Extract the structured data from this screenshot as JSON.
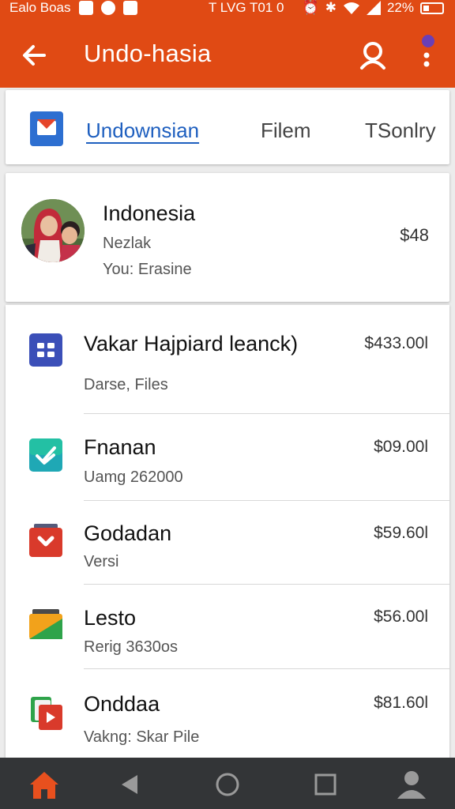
{
  "status_bar": {
    "left_text": "Ealo Boas",
    "center_text": "T LVG T01 0",
    "battery": "22%",
    "left_icons": [
      "notification-icon",
      "circle-icon",
      "calendar-icon"
    ],
    "right_icons": [
      "alarm-icon",
      "bluetooth-icon",
      "wifi-icon",
      "signal-icon",
      "battery-icon"
    ]
  },
  "app_bar": {
    "title": "Undo-hasia",
    "back_icon": "arrow-left-icon",
    "search_icon": "search-icon",
    "more_icon": "more-vertical-icon",
    "accent": "#e04a14"
  },
  "tabs": {
    "items": [
      {
        "label": "Undownsian",
        "active": true
      },
      {
        "label": "Filem",
        "active": false
      },
      {
        "label": "TSonlry",
        "active": false
      }
    ],
    "active_color": "#1e5fbf"
  },
  "profile": {
    "name": "Indonesia",
    "subtitle": "Nezlak",
    "detail": "You: Erasine",
    "price": "$48"
  },
  "items": [
    {
      "title": "Vakar Hajpiard leanck)",
      "subtitle": "Darse, Files",
      "price": "$433.00l",
      "icon": "grid-app-icon",
      "color": "#3b4fb8"
    },
    {
      "title": "Fnanan",
      "subtitle": "Uamg 262000",
      "price": "$09.00l",
      "icon": "checkmark-app-icon",
      "color": "#1fa8b5"
    },
    {
      "title": "Godadan",
      "subtitle": "Versi",
      "price": "$59.60l",
      "icon": "play-folder-icon",
      "color": "#d93a2b"
    },
    {
      "title": "Lesto",
      "subtitle": "Rerig 3630os",
      "price": "$56.00l",
      "icon": "folder-triangle-icon",
      "color": "#f2a21b"
    },
    {
      "title": "Onddaa",
      "subtitle": "Vakng: Skar Pile",
      "price": "$81.60l",
      "icon": "media-copy-icon",
      "color": "#d93a2b"
    }
  ],
  "nav_bar": {
    "buttons": [
      "home-icon",
      "back-triangle-icon",
      "home-circle-icon",
      "recents-square-icon",
      "account-icon"
    ],
    "home_color": "#e8501e"
  }
}
